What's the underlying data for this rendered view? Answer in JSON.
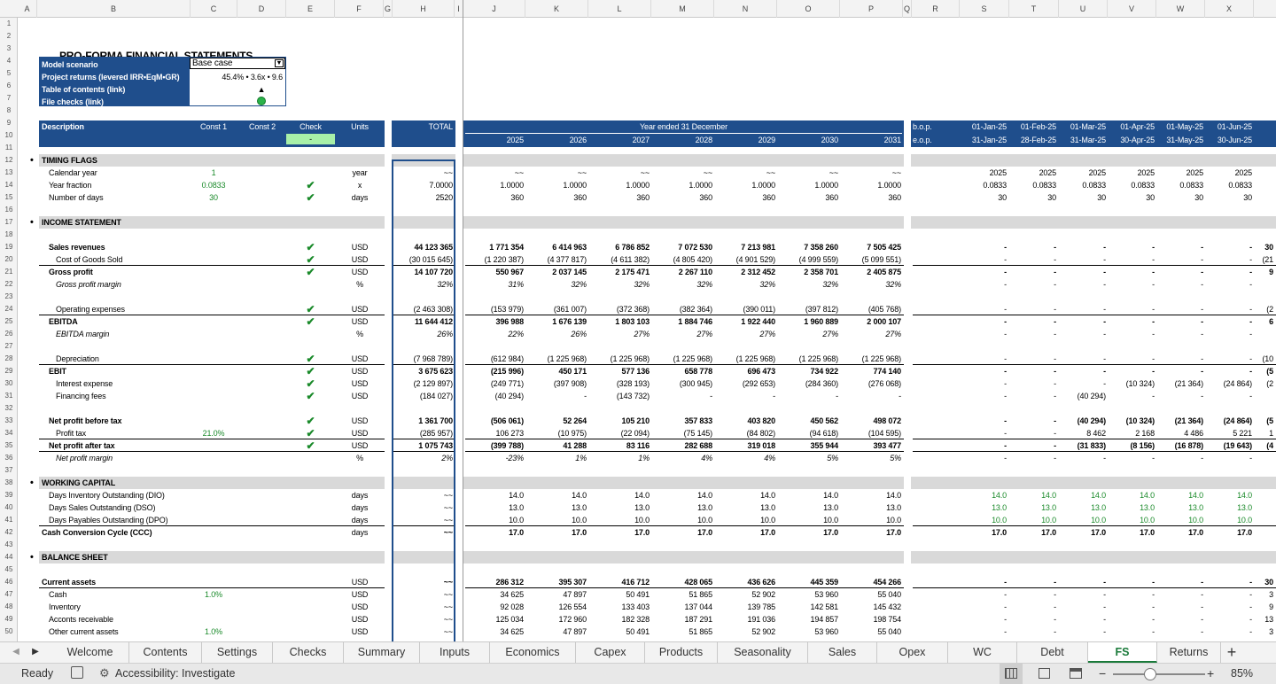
{
  "sheet": {
    "title": "PRO-FORMA FINANCIAL STATEMENTS",
    "columns": [
      "A",
      "B",
      "C",
      "D",
      "E",
      "F",
      "G",
      "H",
      "I",
      "J",
      "K",
      "L",
      "M",
      "N",
      "O",
      "P",
      "Q",
      "R",
      "S",
      "T",
      "U",
      "V",
      "W",
      "X"
    ],
    "rows": [
      "1",
      "2",
      "3",
      "4",
      "5",
      "6",
      "7",
      "8",
      "9",
      "10",
      "11",
      "12",
      "13",
      "14",
      "15",
      "16",
      "17",
      "18",
      "19",
      "20",
      "21",
      "22",
      "23",
      "24",
      "25",
      "26",
      "27",
      "28",
      "29",
      "30",
      "31",
      "32",
      "33",
      "34",
      "35",
      "36",
      "37",
      "38",
      "39",
      "40",
      "41",
      "42",
      "43",
      "44",
      "45",
      "46",
      "47",
      "48",
      "49",
      "50"
    ]
  },
  "info_box": {
    "scenario_label": "Model scenario",
    "scenario_value": "Base case",
    "returns_label": "Project returns (levered IRR•EqM•GR)",
    "returns_value": "45.4% • 3.6x • 9.6",
    "toc_label": "Table of contents (link)",
    "toc_value": "▲",
    "checks_label": "File checks (link)"
  },
  "headers": {
    "description": "Description",
    "const1": "Const 1",
    "const2": "Const 2",
    "check": "Check",
    "check_value": "-",
    "units": "Units",
    "total": "TOTAL",
    "year_ended": "Year ended 31 December",
    "years": [
      "2025",
      "2026",
      "2027",
      "2028",
      "2029",
      "2030",
      "2031"
    ],
    "bop": "b.o.p.",
    "eop": "e.o.p.",
    "months_bop": [
      "01-Jan-25",
      "01-Feb-25",
      "01-Mar-25",
      "01-Apr-25",
      "01-May-25",
      "01-Jun-25",
      "01"
    ],
    "months_eop": [
      "31-Jan-25",
      "28-Feb-25",
      "31-Mar-25",
      "30-Apr-25",
      "31-May-25",
      "30-Jun-25",
      "31"
    ]
  },
  "sections": [
    {
      "row": 12,
      "title": "TIMING FLAGS"
    },
    {
      "row": 17,
      "title": "INCOME STATEMENT"
    },
    {
      "row": 38,
      "title": "WORKING CAPITAL"
    },
    {
      "row": 44,
      "title": "BALANCE SHEET"
    }
  ],
  "lines": [
    {
      "row": 13,
      "label": "Calendar year",
      "c1": "1",
      "check": false,
      "units": "year",
      "total": "~~",
      "years": [
        "~~",
        "~~",
        "~~",
        "~~",
        "~~",
        "~~",
        "~~"
      ],
      "months": [
        "2025",
        "2025",
        "2025",
        "2025",
        "2025",
        "2025",
        ""
      ]
    },
    {
      "row": 14,
      "label": "Year fraction",
      "c1": "0.0833",
      "check": true,
      "units": "x",
      "total": "7.0000",
      "years": [
        "1.0000",
        "1.0000",
        "1.0000",
        "1.0000",
        "1.0000",
        "1.0000",
        "1.0000"
      ],
      "months": [
        "0.0833",
        "0.0833",
        "0.0833",
        "0.0833",
        "0.0833",
        "0.0833",
        ""
      ]
    },
    {
      "row": 15,
      "label": "Number of days",
      "c1": "30",
      "check": true,
      "units": "days",
      "total": "2520",
      "years": [
        "360",
        "360",
        "360",
        "360",
        "360",
        "360",
        "360"
      ],
      "months": [
        "30",
        "30",
        "30",
        "30",
        "30",
        "30",
        ""
      ]
    },
    {
      "row": 19,
      "label": "Sales revenues",
      "bold": true,
      "check": true,
      "units": "USD",
      "total": "44 123 365",
      "years": [
        "1 771 354",
        "6 414 963",
        "6 786 852",
        "7 072 530",
        "7 213 981",
        "7 358 260",
        "7 505 425"
      ],
      "months": [
        "-",
        "-",
        "-",
        "-",
        "-",
        "-",
        "30"
      ]
    },
    {
      "row": 20,
      "label": "Cost of Goods Sold",
      "indent": 2,
      "check": true,
      "units": "USD",
      "total": "(30 015 645)",
      "years": [
        "(1 220 387)",
        "(4 377 817)",
        "(4 611 382)",
        "(4 805 420)",
        "(4 901 529)",
        "(4 999 559)",
        "(5 099 551)"
      ],
      "months": [
        "-",
        "-",
        "-",
        "-",
        "-",
        "-",
        "(21"
      ],
      "uline": true
    },
    {
      "row": 21,
      "label": "Gross profit",
      "bold": true,
      "check": true,
      "units": "USD",
      "total": "14 107 720",
      "years": [
        "550 967",
        "2 037 145",
        "2 175 471",
        "2 267 110",
        "2 312 452",
        "2 358 701",
        "2 405 875"
      ],
      "months": [
        "-",
        "-",
        "-",
        "-",
        "-",
        "-",
        "9"
      ]
    },
    {
      "row": 22,
      "label": "Gross profit margin",
      "italic": true,
      "indent": 2,
      "units": "%",
      "total": "32%",
      "years": [
        "31%",
        "32%",
        "32%",
        "32%",
        "32%",
        "32%",
        "32%"
      ],
      "months": [
        "-",
        "-",
        "-",
        "-",
        "-",
        "-",
        ""
      ]
    },
    {
      "row": 24,
      "label": "Operating expenses",
      "indent": 2,
      "check": true,
      "units": "USD",
      "total": "(2 463 308)",
      "years": [
        "(153 979)",
        "(361 007)",
        "(372 368)",
        "(382 364)",
        "(390 011)",
        "(397 812)",
        "(405 768)"
      ],
      "months": [
        "-",
        "-",
        "-",
        "-",
        "-",
        "-",
        "(2"
      ],
      "uline": true
    },
    {
      "row": 25,
      "label": "EBITDA",
      "bold": true,
      "check": true,
      "units": "USD",
      "total": "11 644 412",
      "years": [
        "396 988",
        "1 676 139",
        "1 803 103",
        "1 884 746",
        "1 922 440",
        "1 960 889",
        "2 000 107"
      ],
      "months": [
        "-",
        "-",
        "-",
        "-",
        "-",
        "-",
        "6"
      ]
    },
    {
      "row": 26,
      "label": "EBITDA margin",
      "italic": true,
      "indent": 2,
      "units": "%",
      "total": "26%",
      "years": [
        "22%",
        "26%",
        "27%",
        "27%",
        "27%",
        "27%",
        "27%"
      ],
      "months": [
        "-",
        "-",
        "-",
        "-",
        "-",
        "-",
        ""
      ]
    },
    {
      "row": 28,
      "label": "Depreciation",
      "indent": 2,
      "check": true,
      "units": "USD",
      "total": "(7 968 789)",
      "years": [
        "(612 984)",
        "(1 225 968)",
        "(1 225 968)",
        "(1 225 968)",
        "(1 225 968)",
        "(1 225 968)",
        "(1 225 968)"
      ],
      "months": [
        "-",
        "-",
        "-",
        "-",
        "-",
        "-",
        "(10"
      ],
      "uline": true
    },
    {
      "row": 29,
      "label": "EBIT",
      "bold": true,
      "check": true,
      "units": "USD",
      "total": "3 675 623",
      "years": [
        "(215 996)",
        "450 171",
        "577 136",
        "658 778",
        "696 473",
        "734 922",
        "774 140"
      ],
      "months": [
        "-",
        "-",
        "-",
        "-",
        "-",
        "-",
        "(5"
      ]
    },
    {
      "row": 30,
      "label": "Interest expense",
      "indent": 2,
      "check": true,
      "units": "USD",
      "total": "(2 129 897)",
      "years": [
        "(249 771)",
        "(397 908)",
        "(328 193)",
        "(300 945)",
        "(292 653)",
        "(284 360)",
        "(276 068)"
      ],
      "months": [
        "-",
        "-",
        "-",
        "(10 324)",
        "(21 364)",
        "(24 864)",
        "(2"
      ]
    },
    {
      "row": 31,
      "label": "Financing fees",
      "indent": 2,
      "check": true,
      "units": "USD",
      "total": "(184 027)",
      "years": [
        "(40 294)",
        "-",
        "(143 732)",
        "-",
        "-",
        "-",
        "-"
      ],
      "months": [
        "-",
        "-",
        "(40 294)",
        "-",
        "-",
        "-",
        ""
      ]
    },
    {
      "row": 33,
      "label": "Net profit before tax",
      "bold": true,
      "check": true,
      "units": "USD",
      "total": "1 361 700",
      "years": [
        "(506 061)",
        "52 264",
        "105 210",
        "357 833",
        "403 820",
        "450 562",
        "498 072"
      ],
      "months": [
        "-",
        "-",
        "(40 294)",
        "(10 324)",
        "(21 364)",
        "(24 864)",
        "(5"
      ]
    },
    {
      "row": 34,
      "label": "Profit tax",
      "indent": 2,
      "c1": "21.0%",
      "check": true,
      "units": "USD",
      "total": "(285 957)",
      "years": [
        "106 273",
        "(10 975)",
        "(22 094)",
        "(75 145)",
        "(84 802)",
        "(94 618)",
        "(104 595)"
      ],
      "months": [
        "-",
        "-",
        "8 462",
        "2 168",
        "4 486",
        "5 221",
        "1"
      ],
      "uline": true
    },
    {
      "row": 35,
      "label": "Net profit after tax",
      "bold": true,
      "check": true,
      "units": "USD",
      "total": "1 075 743",
      "years": [
        "(399 788)",
        "41 288",
        "83 116",
        "282 688",
        "319 018",
        "355 944",
        "393 477"
      ],
      "months": [
        "-",
        "-",
        "(31 833)",
        "(8 156)",
        "(16 878)",
        "(19 643)",
        "(4"
      ],
      "uline": true
    },
    {
      "row": 36,
      "label": "Net profit margin",
      "italic": true,
      "indent": 2,
      "units": "%",
      "total": "2%",
      "years": [
        "-23%",
        "1%",
        "1%",
        "4%",
        "4%",
        "5%",
        "5%"
      ],
      "months": [
        "-",
        "-",
        "-",
        "-",
        "-",
        "-",
        ""
      ]
    },
    {
      "row": 39,
      "label": "Days Inventory Outstanding (DIO)",
      "units": "days",
      "total": "~~",
      "years": [
        "14.0",
        "14.0",
        "14.0",
        "14.0",
        "14.0",
        "14.0",
        "14.0"
      ],
      "months": [
        "14.0",
        "14.0",
        "14.0",
        "14.0",
        "14.0",
        "14.0",
        ""
      ],
      "green_months": true
    },
    {
      "row": 40,
      "label": "Days Sales Outstanding (DSO)",
      "units": "days",
      "total": "~~",
      "years": [
        "13.0",
        "13.0",
        "13.0",
        "13.0",
        "13.0",
        "13.0",
        "13.0"
      ],
      "months": [
        "13.0",
        "13.0",
        "13.0",
        "13.0",
        "13.0",
        "13.0",
        ""
      ],
      "green_months": true
    },
    {
      "row": 41,
      "label": "Days Payables Outstanding (DPO)",
      "units": "days",
      "total": "~~",
      "years": [
        "10.0",
        "10.0",
        "10.0",
        "10.0",
        "10.0",
        "10.0",
        "10.0"
      ],
      "months": [
        "10.0",
        "10.0",
        "10.0",
        "10.0",
        "10.0",
        "10.0",
        ""
      ],
      "green_months": true,
      "uline": true
    },
    {
      "row": 42,
      "label": "Cash Conversion Cycle (CCC)",
      "bold": true,
      "indent": 0,
      "units": "days",
      "total": "~~",
      "years": [
        "17.0",
        "17.0",
        "17.0",
        "17.0",
        "17.0",
        "17.0",
        "17.0"
      ],
      "months": [
        "17.0",
        "17.0",
        "17.0",
        "17.0",
        "17.0",
        "17.0",
        ""
      ]
    },
    {
      "row": 46,
      "label": "Current assets",
      "bold": true,
      "indent": 0,
      "units": "USD",
      "total": "~~",
      "years": [
        "286 312",
        "395 307",
        "416 712",
        "428 065",
        "436 626",
        "445 359",
        "454 266"
      ],
      "months": [
        "-",
        "-",
        "-",
        "-",
        "-",
        "-",
        "30"
      ],
      "uline_top": true
    },
    {
      "row": 47,
      "label": "Cash",
      "c1": "1.0%",
      "units": "USD",
      "total": "~~",
      "years": [
        "34 625",
        "47 897",
        "50 491",
        "51 865",
        "52 902",
        "53 960",
        "55 040"
      ],
      "months": [
        "-",
        "-",
        "-",
        "-",
        "-",
        "-",
        "3"
      ]
    },
    {
      "row": 48,
      "label": "Inventory",
      "units": "USD",
      "total": "~~",
      "years": [
        "92 028",
        "126 554",
        "133 403",
        "137 044",
        "139 785",
        "142 581",
        "145 432"
      ],
      "months": [
        "-",
        "-",
        "-",
        "-",
        "-",
        "-",
        "9"
      ]
    },
    {
      "row": 49,
      "label": "Acconts receivable",
      "units": "USD",
      "total": "~~",
      "years": [
        "125 034",
        "172 960",
        "182 328",
        "187 291",
        "191 036",
        "194 857",
        "198 754"
      ],
      "months": [
        "-",
        "-",
        "-",
        "-",
        "-",
        "-",
        "13"
      ]
    },
    {
      "row": 50,
      "label": "Other current assets",
      "c1": "1.0%",
      "units": "USD",
      "total": "~~",
      "years": [
        "34 625",
        "47 897",
        "50 491",
        "51 865",
        "52 902",
        "53 960",
        "55 040"
      ],
      "months": [
        "-",
        "-",
        "-",
        "-",
        "-",
        "-",
        "3"
      ]
    }
  ],
  "tabs": [
    "Welcome",
    "Contents",
    "Settings",
    "Checks",
    "Summary",
    "Inputs",
    "Economics",
    "Capex",
    "Products",
    "Seasonality",
    "Sales",
    "Opex",
    "WC",
    "Debt",
    "FS",
    "Returns"
  ],
  "active_tab": "FS",
  "tab_nav": {
    "prev": "◀",
    "next": "▶",
    "add": "+"
  },
  "status": {
    "ready": "Ready",
    "accessibility": "Accessibility: Investigate",
    "zoom": "85%",
    "zoom_minus": "−",
    "zoom_plus": "+"
  },
  "colors": {
    "navy": "#1f4e8c",
    "green": "#1a8a2a",
    "gray_band": "#d9d9d9",
    "check_green": "#a8f0a8"
  }
}
